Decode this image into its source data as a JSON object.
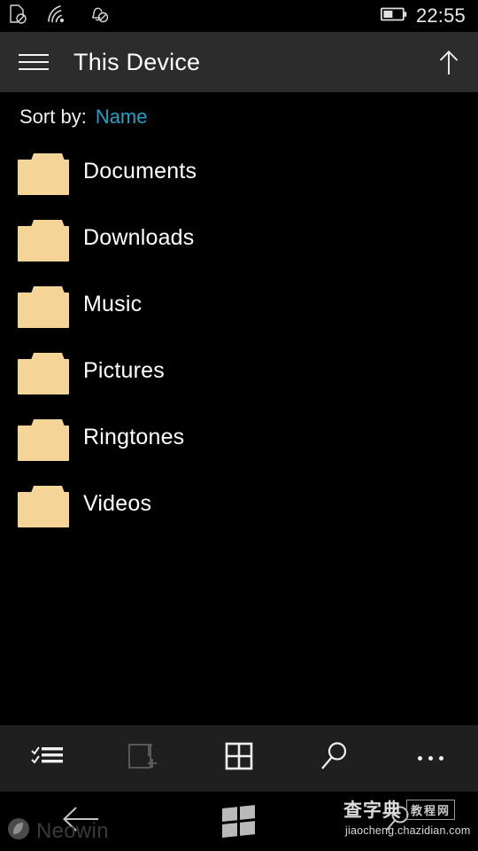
{
  "status_bar": {
    "icons": [
      "sim-card-off-icon",
      "wifi-icon",
      "notifications-off-icon"
    ],
    "battery_icon": "battery-half-icon",
    "clock": "22:55"
  },
  "header": {
    "menu_icon": "hamburger-menu-icon",
    "title": "This Device",
    "up_icon": "arrow-up-icon"
  },
  "sort": {
    "label": "Sort by:",
    "value": "Name",
    "accent_color": "#1fa3c9"
  },
  "folders": [
    {
      "name": "Documents",
      "icon": "folder-icon"
    },
    {
      "name": "Downloads",
      "icon": "folder-icon"
    },
    {
      "name": "Music",
      "icon": "folder-icon"
    },
    {
      "name": "Pictures",
      "icon": "folder-icon"
    },
    {
      "name": "Ringtones",
      "icon": "folder-icon"
    },
    {
      "name": "Videos",
      "icon": "folder-icon"
    }
  ],
  "folder_color": "#f5d498",
  "app_bar": {
    "buttons": [
      {
        "name": "select-icon",
        "label": "Select",
        "enabled": true
      },
      {
        "name": "new-folder-icon",
        "label": "New folder",
        "enabled": false
      },
      {
        "name": "grid-view-icon",
        "label": "View",
        "enabled": true
      },
      {
        "name": "search-icon",
        "label": "Search",
        "enabled": true
      },
      {
        "name": "more-icon",
        "label": "More",
        "enabled": true
      }
    ]
  },
  "nav_bar": {
    "buttons": [
      {
        "name": "back-icon",
        "label": "Back"
      },
      {
        "name": "windows-icon",
        "label": "Start"
      },
      {
        "name": "search-icon",
        "label": "Search"
      }
    ]
  },
  "watermarks": {
    "neowin": "Neowin",
    "chazidian_main": "查字典",
    "chazidian_sub": "教程网",
    "chazidian_url": "jiaocheng.chazidian.com"
  }
}
